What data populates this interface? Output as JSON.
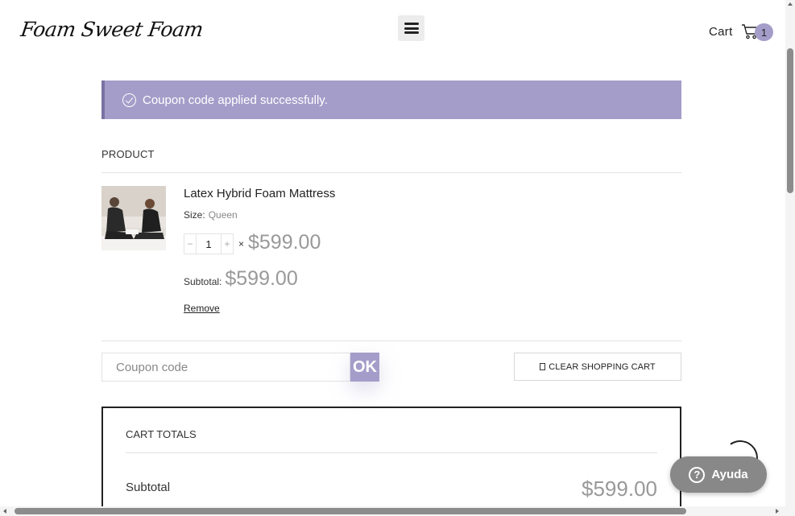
{
  "header": {
    "logo_text": "Foam Sweet Foam",
    "menu_icon": "hamburger-menu-icon",
    "cart_label": "Cart",
    "cart_icon": "shopping-cart-icon",
    "cart_count": "1"
  },
  "notice": {
    "icon": "check-circle-icon",
    "text": "Coupon code applied successfully.",
    "bg_color": "#a59dc9"
  },
  "cart": {
    "column_header": "PRODUCT",
    "items": [
      {
        "name": "Latex Hybrid Foam Mattress",
        "size_label": "Size:",
        "size_value": "Queen",
        "quantity": "1",
        "minus": "−",
        "plus": "+",
        "times": "×",
        "price": "$599.00",
        "subtotal_label": "Subtotal:",
        "subtotal": "$599.00",
        "remove_label": "Remove"
      }
    ],
    "coupon_placeholder": "Coupon code",
    "coupon_button": "OK",
    "clear_button": "CLEAR SHOPPING CART",
    "clear_icon": "trash-icon"
  },
  "totals": {
    "title": "CART TOTALS",
    "subtotal_label": "Subtotal",
    "subtotal_value": "$599.00"
  },
  "help": {
    "label": "Ayuda",
    "icon": "question-circle-icon"
  },
  "colors": {
    "accent": "#a59dc9",
    "price_gray": "#999999"
  }
}
